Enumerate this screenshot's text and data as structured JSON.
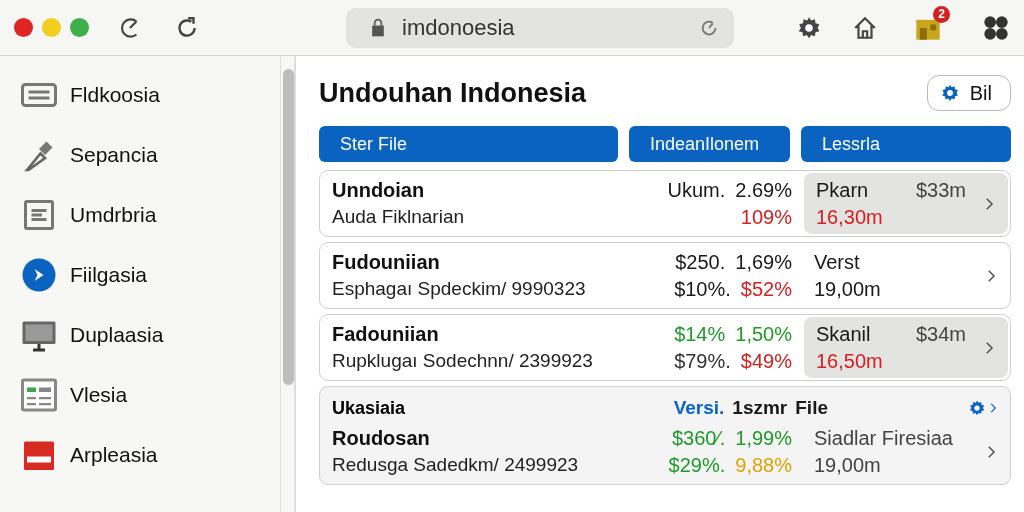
{
  "toolbar": {
    "address": "imdonoesia",
    "badge": "2"
  },
  "sidebar": {
    "items": [
      {
        "label": "Fldkoosia"
      },
      {
        "label": "Sepancia"
      },
      {
        "label": "Umdrbria"
      },
      {
        "label": "Fiilgasia"
      },
      {
        "label": "Duplaasia"
      },
      {
        "label": "Vlesia"
      },
      {
        "label": "Arpleasia"
      }
    ]
  },
  "main": {
    "title": "Undouhan Indonesia",
    "action_button": "Bil",
    "columns": [
      "Ster File",
      "IndeanIlonem",
      "Lessrla"
    ],
    "rows": [
      {
        "highlighted": true,
        "title": "Unndoian",
        "subtitle": "Auda Fiklnarian",
        "figures": [
          [
            {
              "text": "Ukum.",
              "color": "#1a1a1a"
            },
            {
              "text": "2.69%",
              "color": "#1a1a1a"
            }
          ],
          [
            {
              "text": "109%",
              "color": "#d42020"
            }
          ]
        ],
        "side": [
          [
            {
              "text": "Pkarn",
              "color": "#1a1a1a"
            },
            {
              "text": "$33m",
              "color": "#444444"
            }
          ],
          [
            {
              "text": "16,30m",
              "color": "#d42020"
            }
          ]
        ]
      },
      {
        "highlighted": false,
        "title": "Fudouniian",
        "subtitle": "Esphagaı Spdeckim/ 9990323",
        "figures": [
          [
            {
              "text": "$250.",
              "color": "#1a1a1a"
            },
            {
              "text": "1,69%",
              "color": "#1a1a1a"
            }
          ],
          [
            {
              "text": "$10%.",
              "color": "#1a1a1a"
            },
            {
              "text": "$52%",
              "color": "#d42020"
            }
          ]
        ],
        "side": [
          [
            {
              "text": "Verst",
              "color": "#1a1a1a"
            }
          ],
          [
            {
              "text": "19,00m",
              "color": "#1a1a1a"
            }
          ]
        ]
      },
      {
        "highlighted": true,
        "title": "Fadouniian",
        "subtitle": "Rupklugaı Sodechnn/ 2399923",
        "figures": [
          [
            {
              "text": "$14%",
              "color": "#1f9a2a"
            },
            {
              "text": "1,50%",
              "color": "#1f9a2a"
            }
          ],
          [
            {
              "text": "$79%.",
              "color": "#333333"
            },
            {
              "text": "$49%",
              "color": "#d42020"
            }
          ]
        ],
        "side": [
          [
            {
              "text": "Skanil",
              "color": "#1a1a1a"
            },
            {
              "text": "$34m",
              "color": "#444444"
            }
          ],
          [
            {
              "text": "16,50m",
              "color": "#d42020"
            }
          ]
        ]
      },
      {
        "highlighted": false,
        "head": {
          "title": "Ukasiaia",
          "cells": [
            {
              "text": "Versi.",
              "color": "#0a64c8"
            },
            {
              "text": "1szmr",
              "color": "#1a1a1a"
            },
            {
              "text": "File",
              "color": "#1a1a1a"
            }
          ]
        },
        "title": "Roudosan",
        "subtitle": "Redusga Sadedkm/ 2499923",
        "figures": [
          [
            {
              "text": "$360⁄.",
              "color": "#1f9a2a"
            },
            {
              "text": "1,99%",
              "color": "#1f9a2a"
            }
          ],
          [
            {
              "text": "$29%.",
              "color": "#1f9a2a"
            },
            {
              "text": "9,88%",
              "color": "#e0a000"
            }
          ]
        ],
        "side": [
          [
            {
              "text": "Siadlar Firesiaa",
              "color": "#444444"
            }
          ],
          [
            {
              "text": "19,00m",
              "color": "#444444"
            }
          ]
        ]
      }
    ]
  }
}
